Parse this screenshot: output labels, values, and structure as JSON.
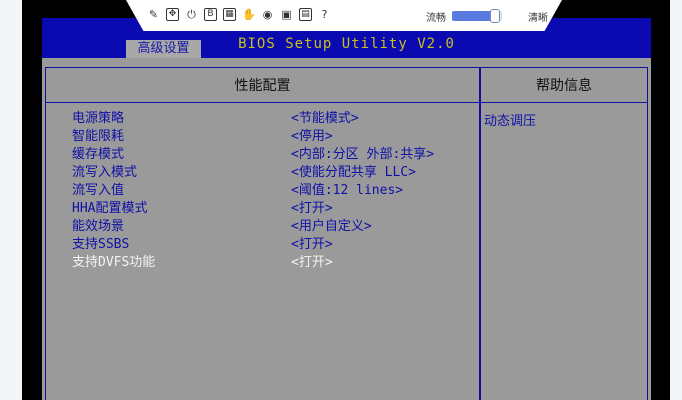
{
  "toolbar": {
    "icons": [
      "pin-icon",
      "move-icon",
      "power-icon",
      "b-icon",
      "grid-icon",
      "hand-icon",
      "disc-icon",
      "video-icon",
      "image-icon",
      "help-icon"
    ],
    "smooth_label": "流畅",
    "clear_label": "清晰",
    "quality_slider_value": 0.85
  },
  "bios": {
    "title": "BIOS Setup Utility V2.0",
    "active_tab": "高级设置",
    "main_column_title": "性能配置",
    "help_column_title": "帮助信息",
    "help_text": "动态调压",
    "items": [
      {
        "label": "电源策略",
        "value": "<节能模式>"
      },
      {
        "label": "智能限耗",
        "value": "<停用>"
      },
      {
        "label": "缓存模式",
        "value": "<内部:分区 外部:共享>"
      },
      {
        "label": "流写入模式",
        "value": "<使能分配共享 LLC>"
      },
      {
        "label": "流写入值",
        "value": "<阈值:12 lines>"
      },
      {
        "label": "HHA配置模式",
        "value": "<打开>"
      },
      {
        "label": "能效场景",
        "value": "<用户自定义>"
      },
      {
        "label": "支持SSBS",
        "value": "<打开>"
      },
      {
        "label": "支持DVFS功能",
        "value": "<打开>"
      }
    ],
    "selected_index": 8
  },
  "colors": {
    "bios_blue": "#0a0ab0",
    "bios_gray": "#9a9a9a",
    "text_blue": "#1010a8",
    "selected_text": "#f4f4f4",
    "title_yellow": "#c8c020"
  }
}
